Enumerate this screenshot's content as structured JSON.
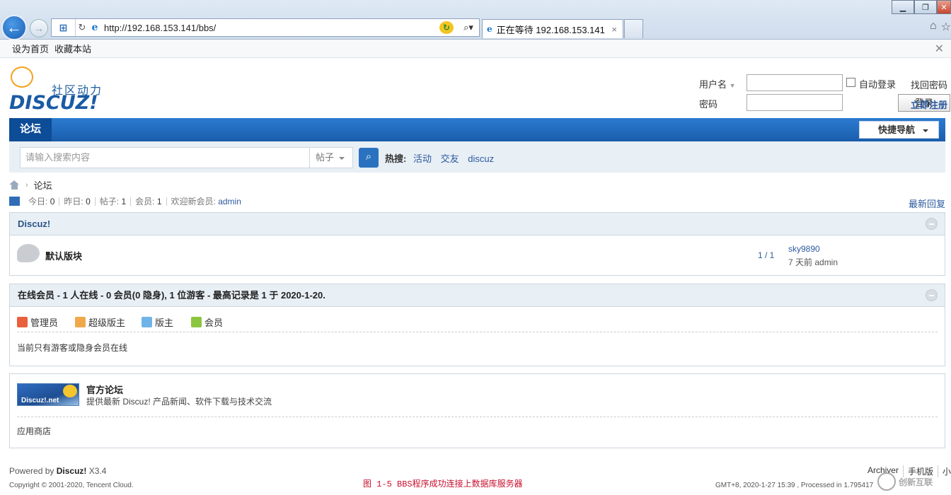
{
  "browser": {
    "url": "http://192.168.153.141/bbs/",
    "tab_title": "正在等待 192.168.153.141",
    "tab_close": "×"
  },
  "favorites": {
    "set_home": "设为首页",
    "bookmark": "收藏本站"
  },
  "logo": {
    "cn": "社区动力",
    "en": "DISCUZ!"
  },
  "login": {
    "username_label": "用户名",
    "password_label": "密码",
    "auto_login": "自动登录",
    "forgot_password": "找回密码",
    "login_button": "登录",
    "register": "立即注册"
  },
  "nav": {
    "current": "论坛",
    "quick_nav": "快捷导航"
  },
  "search": {
    "placeholder": "请输入搜索内容",
    "type": "帖子",
    "hot_label": "热搜:",
    "hot_keywords": [
      "活动",
      "交友",
      "discuz"
    ]
  },
  "breadcrumb": {
    "current": "论坛"
  },
  "stats": {
    "today_label": "今日:",
    "today": "0",
    "yesterday_label": "昨日:",
    "yesterday": "0",
    "posts_label": "帖子:",
    "posts": "1",
    "members_label": "会员:",
    "members": "1",
    "welcome_label": "欢迎新会员:",
    "newest_member": "admin",
    "latest_replies": "最新回复"
  },
  "category": {
    "title": "Discuz!",
    "forum": {
      "name": "默认版块",
      "count": "1 / 1",
      "last_post_user": "sky9890",
      "last_post_time": "7 天前 admin"
    }
  },
  "online": {
    "title": "在线会员 - 1 人在线 - 0 会员(0 隐身), 1 位游客 - 最高记录是 1 于 2020-1-20.",
    "legend": [
      {
        "label": "管理员",
        "color": "#e8613c"
      },
      {
        "label": "超级版主",
        "color": "#f0a94a"
      },
      {
        "label": "版主",
        "color": "#6fb4e8"
      },
      {
        "label": "会员",
        "color": "#8cc63f"
      }
    ],
    "message": "当前只有游客或隐身会员在线"
  },
  "links": {
    "logo_text": "Discuz!.net",
    "name": "官方论坛",
    "desc": "提供最新 Discuz! 产品新闻、软件下载与技术交流",
    "app_store": "应用商店"
  },
  "footer": {
    "powered_prefix": "Powered by",
    "powered_brand": "Discuz!",
    "version": "X3.4",
    "copyright": "Copyright © 2001-2020, Tencent Cloud.",
    "caption": "图 1-5 BBS程序成功连接上数据库服务器",
    "links": [
      "Archiver",
      "手机版",
      "小"
    ],
    "process_info": "GMT+8, 2020-1-27 15:39 , Processed in 1.795417",
    "watermark": "创新互联"
  }
}
